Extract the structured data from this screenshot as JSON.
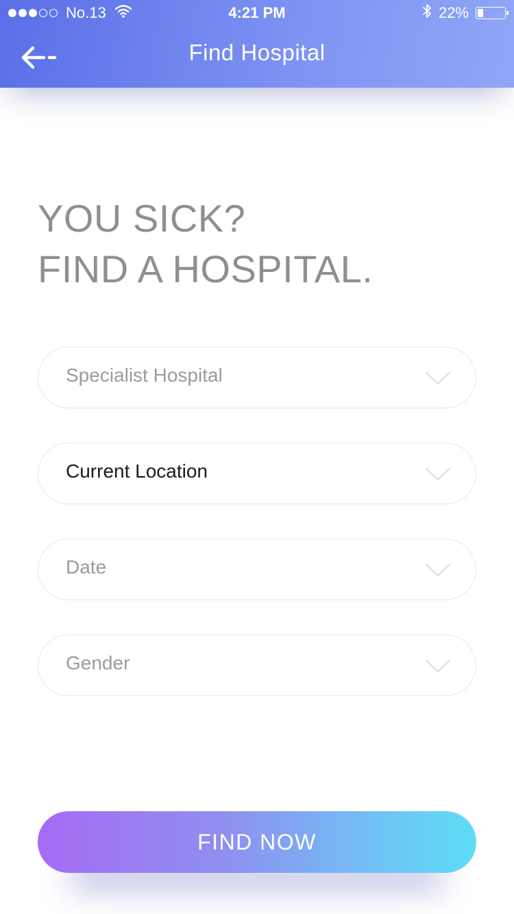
{
  "status_bar": {
    "signal_dots": [
      true,
      true,
      true,
      false,
      false
    ],
    "carrier": "No.13",
    "time": "4:21 PM",
    "battery_text": "22%",
    "battery_level": 0.22,
    "icons": [
      "signal-icon",
      "wifi-icon",
      "bluetooth-icon",
      "battery-icon"
    ]
  },
  "nav": {
    "title": "Find Hospital",
    "back_icon": "back-arrow-icon"
  },
  "headline": {
    "line1": "YOU SICK?",
    "line2": "FIND A HOSPITAL."
  },
  "fields": [
    {
      "label": "Specialist Hospital",
      "state": "placeholder",
      "icon": "chevron-down-icon"
    },
    {
      "label": "Current Location",
      "state": "selected",
      "icon": "chevron-down-icon"
    },
    {
      "label": "Date",
      "state": "placeholder",
      "icon": "chevron-down-icon"
    },
    {
      "label": "Gender",
      "state": "placeholder",
      "icon": "chevron-down-icon"
    }
  ],
  "cta": {
    "label": "FIND NOW"
  },
  "colors": {
    "header_start": "#5a6ee8",
    "header_end": "#90a6f6",
    "headline": "#8f8f8f",
    "placeholder_text": "#9b9b9b",
    "selected_text": "#1b1b1b",
    "field_border": "#e7e7ea",
    "cta_start": "#a56bf5",
    "cta_end": "#5edcf5"
  }
}
